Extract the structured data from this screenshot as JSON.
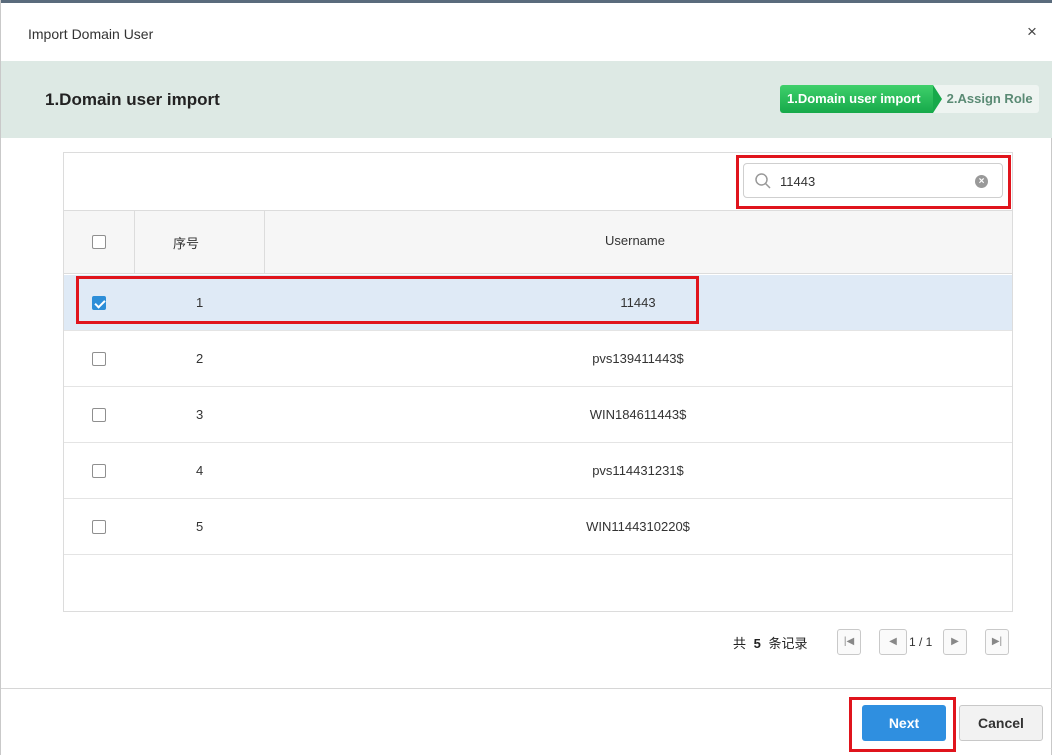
{
  "dialog": {
    "title": "Import Domain User",
    "close_icon": "×"
  },
  "step_header": {
    "title": "1.Domain user import",
    "steps": [
      {
        "label": "1.Domain user import",
        "active": true
      },
      {
        "label": "2.Assign Role",
        "active": false
      }
    ],
    "active_color": "#16a94a"
  },
  "search": {
    "value": "11443",
    "placeholder": "",
    "clear_icon": "clear-icon",
    "icon": "search-icon"
  },
  "table": {
    "columns": [
      "序号",
      "Username"
    ],
    "rows": [
      {
        "index": "1",
        "username": "11443",
        "checked": true
      },
      {
        "index": "2",
        "username": "pvs139411443$",
        "checked": false
      },
      {
        "index": "3",
        "username": "WIN184611443$",
        "checked": false
      },
      {
        "index": "4",
        "username": "pvs114431231$",
        "checked": false
      },
      {
        "index": "5",
        "username": "WIN1144310220$",
        "checked": false
      }
    ]
  },
  "pager": {
    "total_prefix": "共",
    "total_count": "5",
    "total_suffix": "条记录",
    "page_text": "1 / 1"
  },
  "footer": {
    "next_label": "Next",
    "cancel_label": "Cancel",
    "next_color": "#2f8fe0"
  },
  "highlight_color": "#e0141c"
}
